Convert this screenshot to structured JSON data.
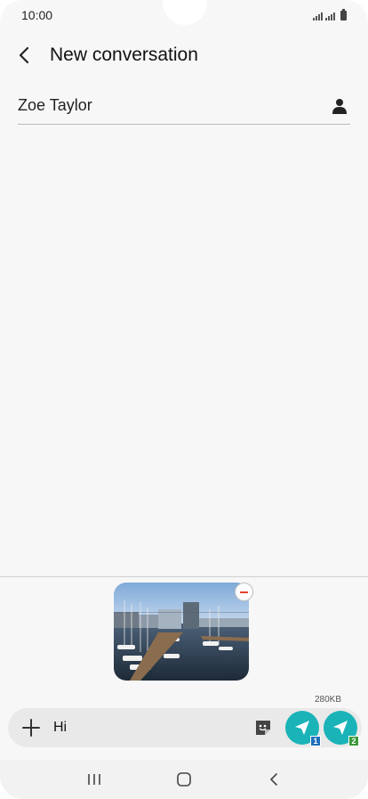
{
  "status_bar": {
    "time": "10:00"
  },
  "app_bar": {
    "title": "New conversation"
  },
  "recipient": {
    "name": "Zoe Taylor"
  },
  "attachment": {
    "size": "280KB"
  },
  "composer": {
    "text": "Hi"
  },
  "send_buttons": [
    {
      "sim": "1",
      "badge_color": "#1e6fb8"
    },
    {
      "sim": "2",
      "badge_color": "#3a9a3a"
    }
  ],
  "colors": {
    "accent": "#1ab3b8",
    "remove": "#e0462d"
  }
}
